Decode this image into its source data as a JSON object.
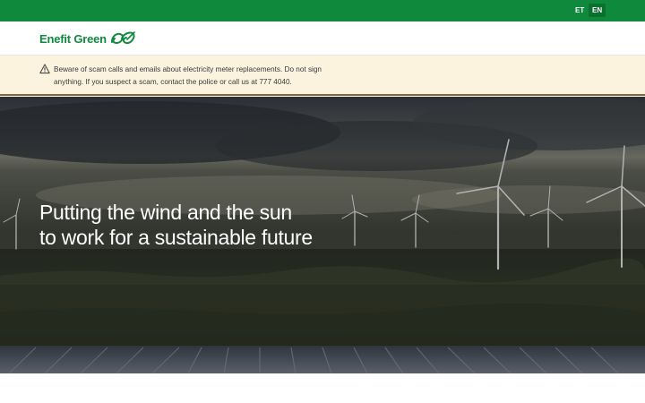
{
  "topbar": {
    "languages": [
      {
        "code": "ET",
        "active": false
      },
      {
        "code": "EN",
        "active": true
      }
    ],
    "background": "#0f8a3c"
  },
  "header": {
    "logo_text": "Enefit Green",
    "logo_icon": "leaf-loop-logo-icon",
    "brand_color": "#0f8a3c"
  },
  "alert": {
    "icon": "warning-triangle-icon",
    "text": "Beware of scam calls and emails about electricity meter replacements. Do not sign anything. If you suspect a scam, contact the police or call us at 777 4040.",
    "background": "#fcf3df"
  },
  "hero": {
    "title_line1": "Putting the wind and the sun",
    "title_line2": "to work for a sustainable future"
  }
}
